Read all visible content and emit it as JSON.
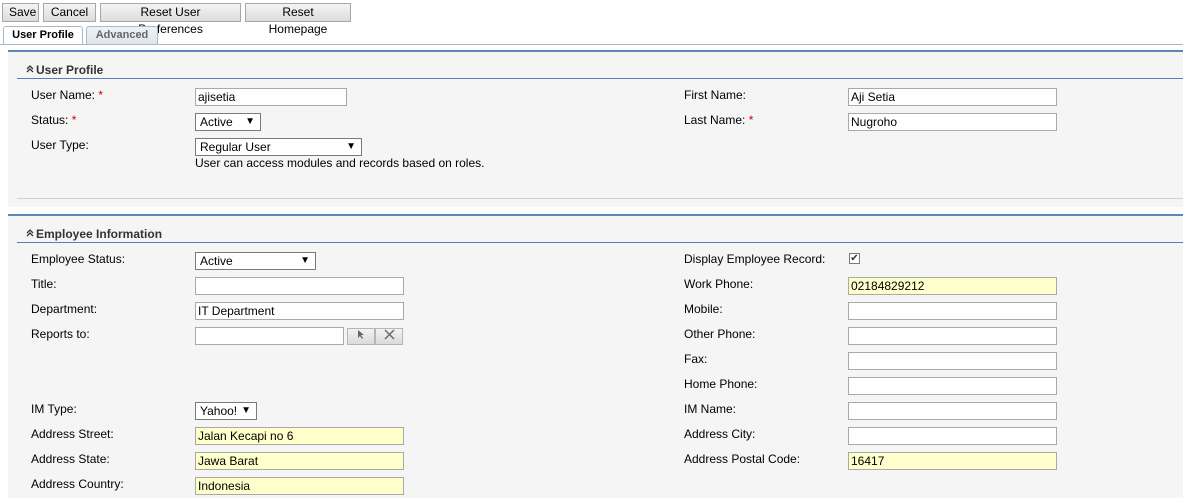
{
  "toolbar": {
    "save": "Save",
    "cancel": "Cancel",
    "reset_prefs": "Reset User Preferences",
    "reset_home": "Reset Homepage"
  },
  "tabs": [
    {
      "label": "User Profile",
      "active": true
    },
    {
      "label": "Advanced",
      "active": false
    }
  ],
  "user_profile": {
    "title": "User Profile",
    "user_name_label": "User Name:",
    "user_name": "ajisetia",
    "status_label": "Status:",
    "status": "Active",
    "user_type_label": "User Type:",
    "user_type": "Regular User",
    "user_type_hint": "User can access modules and records based on roles.",
    "first_name_label": "First Name:",
    "first_name": "Aji Setia",
    "last_name_label": "Last Name:",
    "last_name": "Nugroho",
    "required_mark": "*"
  },
  "employee": {
    "title": "Employee Information",
    "employee_status_label": "Employee Status:",
    "employee_status": "Active",
    "title_label": "Title:",
    "title_value": "",
    "department_label": "Department:",
    "department": "IT Department",
    "reports_to_label": "Reports to:",
    "reports_to": "",
    "im_type_label": "IM Type:",
    "im_type": "Yahoo!",
    "address_street_label": "Address Street:",
    "address_street": "Jalan Kecapi no 6",
    "address_state_label": "Address State:",
    "address_state": "Jawa Barat",
    "address_country_label": "Address Country:",
    "address_country": "Indonesia",
    "display_record_label": "Display Employee Record:",
    "display_record_checked": true,
    "work_phone_label": "Work Phone:",
    "work_phone": "02184829212",
    "mobile_label": "Mobile:",
    "mobile": "",
    "other_phone_label": "Other Phone:",
    "other_phone": "",
    "fax_label": "Fax:",
    "fax": "",
    "home_phone_label": "Home Phone:",
    "home_phone": "",
    "im_name_label": "IM Name:",
    "im_name": "",
    "address_city_label": "Address City:",
    "address_city": "",
    "postal_code_label": "Address Postal Code:",
    "postal_code": "16417"
  },
  "icons": {
    "dropdown": "▼",
    "collapse": "chevron-double-up-icon",
    "select": "cursor-arrow-icon",
    "clear": "clear-x-icon",
    "check": "✔"
  }
}
